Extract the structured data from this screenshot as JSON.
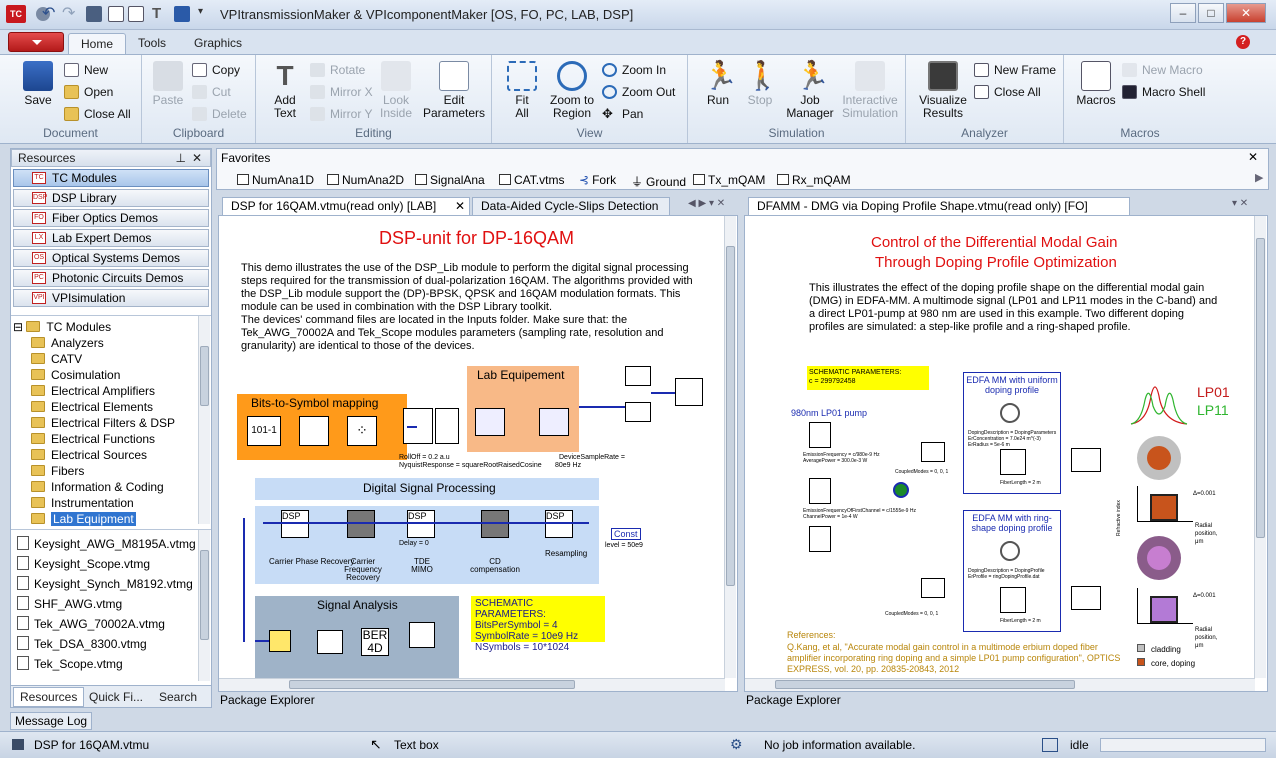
{
  "window": {
    "title": "VPItransmissionMaker & VPIcomponentMaker [OS, FO, PC, LAB, DSP]",
    "logo": "TC",
    "controls": [
      "–",
      "□",
      "✕"
    ]
  },
  "ribbon_tabs": [
    "Home",
    "Tools",
    "Graphics"
  ],
  "ribbon": {
    "document": {
      "label": "Document",
      "save": "Save",
      "new": "New",
      "open": "Open",
      "close_all": "Close All"
    },
    "clipboard": {
      "label": "Clipboard",
      "paste": "Paste",
      "copy": "Copy",
      "cut": "Cut",
      "delete": "Delete"
    },
    "editing": {
      "label": "Editing",
      "add_text_1": "Add",
      "add_text_2": "Text",
      "rotate": "Rotate",
      "mirror_x": "Mirror X",
      "mirror_y": "Mirror Y",
      "look_inside_1": "Look",
      "look_inside_2": "Inside",
      "edit_params_1": "Edit",
      "edit_params_2": "Parameters"
    },
    "view": {
      "label": "View",
      "fit_1": "Fit",
      "fit_2": "All",
      "zoom_region_1": "Zoom to",
      "zoom_region_2": "Region",
      "zoom_in": "Zoom In",
      "zoom_out": "Zoom Out",
      "pan": "Pan"
    },
    "simulation": {
      "label": "Simulation",
      "run": "Run",
      "stop": "Stop",
      "job_manager_1": "Job",
      "job_manager_2": "Manager",
      "interactive_1": "Interactive",
      "interactive_2": "Simulation"
    },
    "analyzer": {
      "label": "Analyzer",
      "visualize_1": "Visualize",
      "visualize_2": "Results",
      "new_frame": "New Frame",
      "close_all": "Close All"
    },
    "macros": {
      "label": "Macros",
      "macros": "Macros",
      "new_macro": "New Macro",
      "macro_shell": "Macro Shell"
    }
  },
  "resources": {
    "title": "Resources",
    "items": [
      {
        "label": "TC Modules",
        "icon": "TC"
      },
      {
        "label": "DSP Library",
        "icon": "DSP"
      },
      {
        "label": "Fiber Optics Demos",
        "icon": "FO"
      },
      {
        "label": "Lab Expert Demos",
        "icon": "LX"
      },
      {
        "label": "Optical Systems Demos",
        "icon": "OS"
      },
      {
        "label": "Photonic Circuits Demos",
        "icon": "PC"
      },
      {
        "label": "VPIsimulation",
        "icon": "VPI"
      }
    ],
    "tree_root": "TC Modules",
    "tree": [
      "Analyzers",
      "CATV",
      "Cosimulation",
      "Electrical Amplifiers",
      "Electrical Elements",
      "Electrical Filters & DSP",
      "Electrical Functions",
      "Electrical Sources",
      "Fibers",
      "Information & Coding",
      "Instrumentation",
      "Lab Equipment"
    ],
    "files": [
      "Keysight_AWG_M8195A.vtmg",
      "Keysight_Scope.vtmg",
      "Keysight_Synch_M8192.vtmg",
      "SHF_AWG.vtmg",
      "Tek_AWG_70002A.vtmg",
      "Tek_DSA_8300.vtmg",
      "Tek_Scope.vtmg"
    ],
    "bottom_tabs": [
      "Resources",
      "Quick Fi...",
      "Search"
    ]
  },
  "favorites": {
    "title": "Favorites",
    "items": [
      "NumAna1D",
      "NumAna2D",
      "SignalAna",
      "CAT.vtms",
      "Fork",
      "Ground",
      "Tx_mQAM",
      "Rx_mQAM"
    ]
  },
  "left_doc": {
    "tabs": [
      "DSP for 16QAM.vtmu(read only) [LAB]",
      "Data-Aided Cycle-Slips Detection"
    ],
    "title": "DSP-unit for DP-16QAM",
    "description": "This demo illustrates the use of the DSP_Lib module to perform the digital signal processing steps required for the transmission of dual-polarization 16QAM. The algorithms provided with the DSP_Lib module support the (DP)-BPSK, QPSK and 16QAM modulation formats. This module can be used in combination with the DSP Library toolkit.",
    "description2": "The devices' command files are located in the Inputs folder. Make sure that: the Tek_AWG_70002A and Tek_Scope modules parameters (sampling rate, resolution and granularity) are identical to those of the devices.",
    "bits_to_symbol": "Bits-to-Symbol mapping",
    "lab_equipment": "Lab Equipement",
    "digital_signal_processing": "Digital Signal Processing",
    "signal_analysis": "Signal Analysis",
    "block_101": "101-1",
    "dsp_blocks": [
      "Carrier Phase Recovery",
      "Carrier Frequency Recovery",
      "TDE MIMO",
      "CD compensation",
      "Resampling"
    ],
    "rolloff": "RollOff = 0.2 a.u",
    "nyquist": "NyquistResponse = squareRootRaisedCosine",
    "device_rate": "DeviceSampleRate =",
    "rate_value": "80e9 Hz",
    "delay": "Delay = 0",
    "const": "Const",
    "level": "level = 50e9",
    "ber": "BER",
    "ber_sub": "4D",
    "schematic": {
      "title": "SCHEMATIC PARAMETERS:",
      "lines": [
        "BitsPerSymbol = 4",
        "SymbolRate = 10e9 Hz",
        "NSymbols = 10*1024"
      ]
    }
  },
  "right_doc": {
    "tab": "DFAMM - DMG via Doping Profile Shape.vtmu(read only) [FO]",
    "title1": "Control of the Differential Modal Gain",
    "title2": "Through Doping Profile Optimization",
    "description": "This illustrates the effect of the doping profile shape on the differential modal gain (DMG) in EDFA-MM. A multimode signal (LP01 and LP11 modes in the C-band) and a direct LP01-pump at 980 nm are used in this example. Two different doping profiles are simulated: a step-like profile and a ring-shaped profile.",
    "schematic_title": "SCHEMATIC PARAMETERS:",
    "schematic_c": "c = 299792458",
    "pump_label": "980nm LP01 pump",
    "edfa_uniform": "EDFA MM with uniform doping profile",
    "edfa_ring": "EDFA MM with ring-shape doping profile",
    "lp01": "LP01",
    "lp11": "LP11",
    "references_title": "References:",
    "reference": "Q.Kang, et al, \"Accurate modal gain control in a multimode erbium doped fiber amplifier incorporating ring doping and a simple LP01 pump configuration\", OPTICS EXPRESS, vol. 20, pp. 20835-20843, 2012",
    "legend": [
      "cladding",
      "core, doping"
    ],
    "small_labels": {
      "freq_pump": "EmissionFrequency = c/980e-9 Hz",
      "power_pump": "AveragePower = 300.0e-3 W",
      "freq_ch1": "EmissionFrequencyOfFirstChannel = c/1555e-9 Hz",
      "power_ch1": "ChannelPower = 1e-4 W",
      "coupled1": "CoupledModes = 0, 0, 1",
      "coupled2": "CoupledModes = 0, 0, 1",
      "doping_desc": "DopingDescription = DopingParameters",
      "er_conc": "ErConcentration = 7.0e24 m^(-3)",
      "er_radius": "ErRadius = 5e-6 m",
      "fiber_len": "FiberLength = 2 m",
      "doping_desc2": "DopingDescription = DopingProfile",
      "er_profile": "ErProfile = ringDopingProfile.dat",
      "fiber_len2": "FiberLength = 2 m",
      "delta1": "Δ=0.001",
      "delta2": "Δ=0.001",
      "radial1": "Radial position, μm",
      "radial2": "Radial position, μm",
      "rindex": "Refractive index"
    }
  },
  "package_explorer": "Package Explorer",
  "message_log": "Message Log",
  "status": {
    "doc": "DSP for 16QAM.vtmu",
    "tool": "Text box",
    "jobs": "No job information available.",
    "state": "idle"
  }
}
